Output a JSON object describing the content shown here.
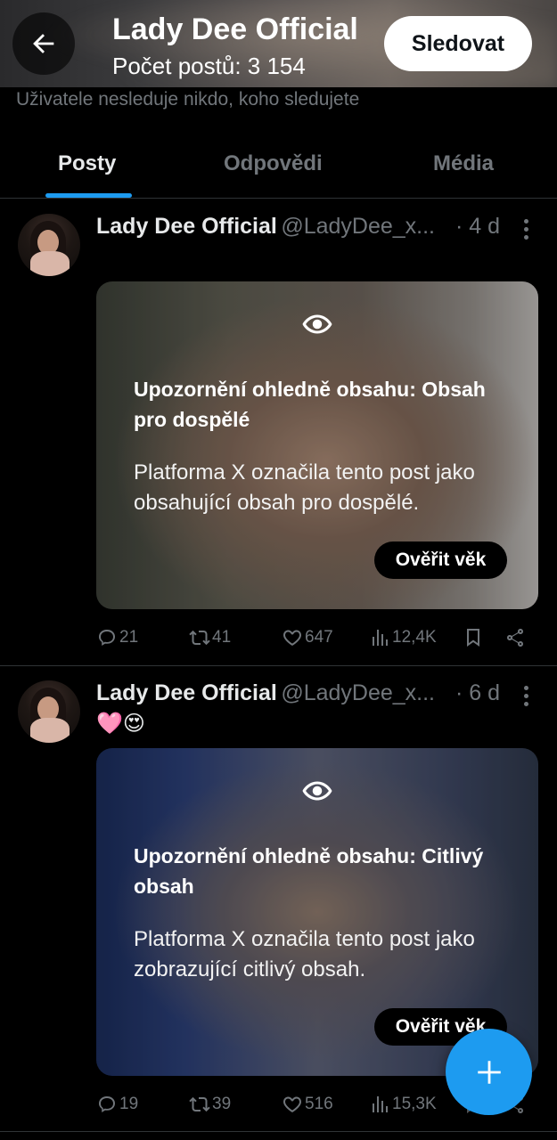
{
  "header": {
    "title": "Lady Dee Official",
    "post_count": "Počet postů: 3 154",
    "follow_label": "Sledovat"
  },
  "follow_note": "Uživatele nesleduje nikdo, koho sledujete",
  "tabs": [
    {
      "label": "Posty",
      "active": true
    },
    {
      "label": "Odpovědi",
      "active": false
    },
    {
      "label": "Média",
      "active": false
    }
  ],
  "posts": [
    {
      "name": "Lady Dee Official",
      "handle": "@LadyDee_x...",
      "time": "· 4 d",
      "text": "",
      "warning_title": "Upozornění ohledně obsahu: Obsah pro dospělé",
      "warning_text": "Platforma X označila tento post jako obsahující obsah pro dospělé.",
      "verify_label": "Ověřit věk",
      "replies": "21",
      "reposts": "41",
      "likes": "647",
      "views": "12,4K"
    },
    {
      "name": "Lady Dee Official",
      "handle": "@LadyDee_x...",
      "time": "· 6 d",
      "text": "🩷😍",
      "warning_title": "Upozornění ohledně obsahu: Citlivý obsah",
      "warning_text": "Platforma X označila tento post jako zobrazující citlivý obsah.",
      "verify_label": "Ověřit věk",
      "replies": "19",
      "reposts": "39",
      "likes": "516",
      "views": "15,3K"
    }
  ],
  "colors": {
    "accent": "#1d9bf0",
    "background": "#000000",
    "secondary_text": "#71767b"
  }
}
